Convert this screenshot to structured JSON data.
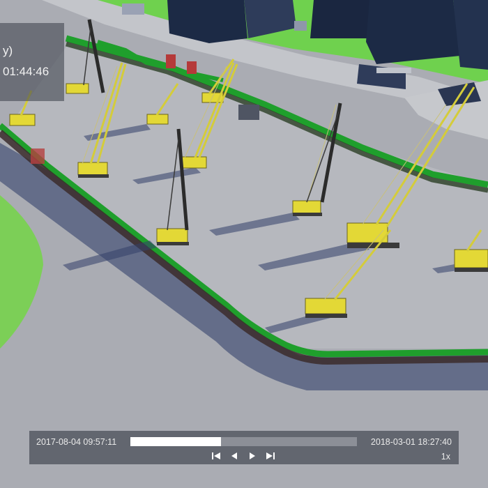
{
  "info_panel": {
    "title_fragment": "y)",
    "time_fragment": "01:44:46"
  },
  "timeline": {
    "start_datetime": "2017-08-04 09:57:11",
    "end_datetime": "2018-03-01 18:27:40",
    "progress_fraction": 0.4,
    "speed_label": "1x",
    "controls": [
      "skip-to-start-icon",
      "step-back-icon",
      "play-icon",
      "skip-to-end-icon"
    ]
  },
  "colors": {
    "ground": "#a9abb2",
    "grass": "#6fd14e",
    "fence": "#1f9f2c",
    "crane_body": "#e3d836",
    "building": "#1c2a45"
  }
}
